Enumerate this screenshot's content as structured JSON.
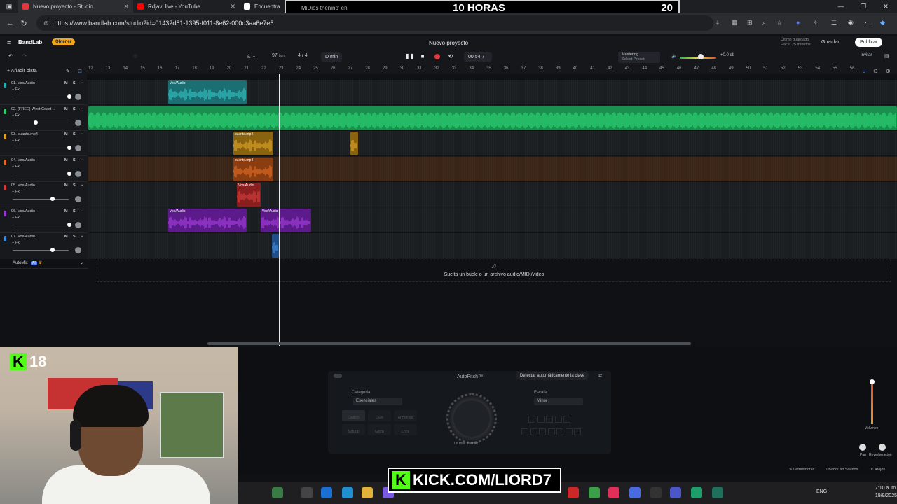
{
  "browser": {
    "tabs": [
      {
        "label": "Nuevo proyecto - Studio",
        "active": true,
        "color": "#e4363c"
      },
      {
        "label": "Rdjavi live - YouTube",
        "active": false,
        "color": "#ff0000"
      },
      {
        "label": "Encuentra",
        "active": false,
        "color": "#ffffff"
      }
    ],
    "url": "https://www.bandlab.com/studio?id=01432d51-1395-f011-8e62-000d3aa6e7e5"
  },
  "stream_overlay": {
    "hours_label": "10 HORAS",
    "counter": "20",
    "search_snippet": "MiDios thenino' en",
    "kick_followers": "18",
    "kick_url": "KICK.COM/LIORD7"
  },
  "bandlab": {
    "logo": "BandLab",
    "obtener": "Obtener",
    "project_title": "Nuevo proyecto",
    "saved_status": "Último guardado",
    "saved_time": "Hace: 25 minutos",
    "guardar": "Guardar",
    "publicar": "Publicar",
    "transport": {
      "bpm": "97",
      "bpm_unit": "bpm",
      "time_sig": "4 / 4",
      "key": "D min",
      "time": "00:54.7",
      "mastering_title": "Mastering",
      "mastering_sub": "Select Preset",
      "db": "+0.0 db",
      "invitar": "Invitar"
    },
    "add_track": "Añadir pista",
    "ruler": [
      "12",
      "13",
      "14",
      "15",
      "16",
      "17",
      "18",
      "19",
      "20",
      "21",
      "22",
      "23",
      "24",
      "25",
      "26",
      "27",
      "28",
      "29",
      "30",
      "31",
      "32",
      "33",
      "34",
      "35",
      "36",
      "37",
      "38",
      "39",
      "40",
      "41",
      "42",
      "43",
      "44",
      "45",
      "46",
      "47",
      "48",
      "49",
      "50",
      "51",
      "52",
      "53",
      "54",
      "55",
      "56"
    ],
    "tracks": [
      {
        "name": "01. Vox/Audio",
        "color": "#23b0b0",
        "fx": "+ Fx"
      },
      {
        "name": "02. (FREE) West Coast ...",
        "color": "#2ecc71",
        "fx": "+ Fx"
      },
      {
        "name": "03. cuanto.mp4",
        "color": "#e0a21e",
        "fx": "+ Fx"
      },
      {
        "name": "04. Vox/Audio",
        "color": "#e06a1e",
        "fx": "+ Fx"
      },
      {
        "name": "05. Vox/Audio",
        "color": "#d63a3a",
        "fx": "+ Fx"
      },
      {
        "name": "06. Vox/Audio",
        "color": "#9b30d9",
        "fx": "+ Fx"
      },
      {
        "name": "07. Vox/Audio",
        "color": "#3a8de0",
        "fx": "+ Fx"
      }
    ],
    "clip_labels": {
      "vox": "Vox/Audio",
      "cuanto": "cuanto.mp4"
    },
    "mute": "M",
    "solo": "S",
    "automix": "AutoMix",
    "automix_badge": "AI",
    "dropzone": "Suelta un bucle o un archivo audio/MIDI/video",
    "autopitch": {
      "title": "AutoPitch™",
      "detect_btn": "Detectar automáticamente la clave",
      "category_label": "Categoría",
      "category_value": "Esenciales",
      "scale_label": "Escala",
      "scale_value": "Minor",
      "presets": [
        "Clásico",
        "Duet",
        "Armonías",
        "Natural",
        "Glitch",
        "Choir"
      ],
      "knob_label": "Lo más intenso"
    },
    "volume_label": "Volumen",
    "pan_label": "Pan",
    "reverb_label": "Reverberación",
    "footer": {
      "lyrics": "Letras/notas",
      "sounds": "BandLab Sounds",
      "shortcuts": "Atajos"
    }
  },
  "taskbar": {
    "lang": "ENG",
    "time": "7:10 a. m.",
    "date": "19/9/2025"
  }
}
